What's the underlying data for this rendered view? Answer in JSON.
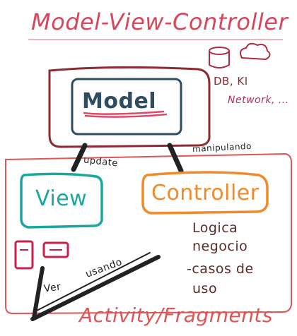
{
  "title": "Model-View-Controller",
  "model": {
    "label": "Model"
  },
  "storage": {
    "db_label": "DB, KI",
    "network_label": "Network, ..."
  },
  "arrows": {
    "update_label": "update",
    "manipulating_label": "manipulando",
    "using_label": "usando",
    "see_label": "Ver"
  },
  "view": {
    "label": "View"
  },
  "controller": {
    "label": "Controller",
    "notes": [
      "Logica",
      "negocio",
      "-casos de",
      "uso"
    ]
  },
  "bottom": {
    "label": "Activity/Fragments"
  },
  "colors": {
    "title": "#d9455a",
    "model_box": "#8b2a2f",
    "model_inner": "#2f4c60",
    "model_text": "#2f4c60",
    "model_underline": "#e04a6a",
    "view": "#1aa89e",
    "controller": "#f08a2a",
    "container": "#e05555",
    "notes": "#5a2a2a",
    "network": "#b03060",
    "icons": "#b02a40",
    "arrow": "#222222"
  }
}
